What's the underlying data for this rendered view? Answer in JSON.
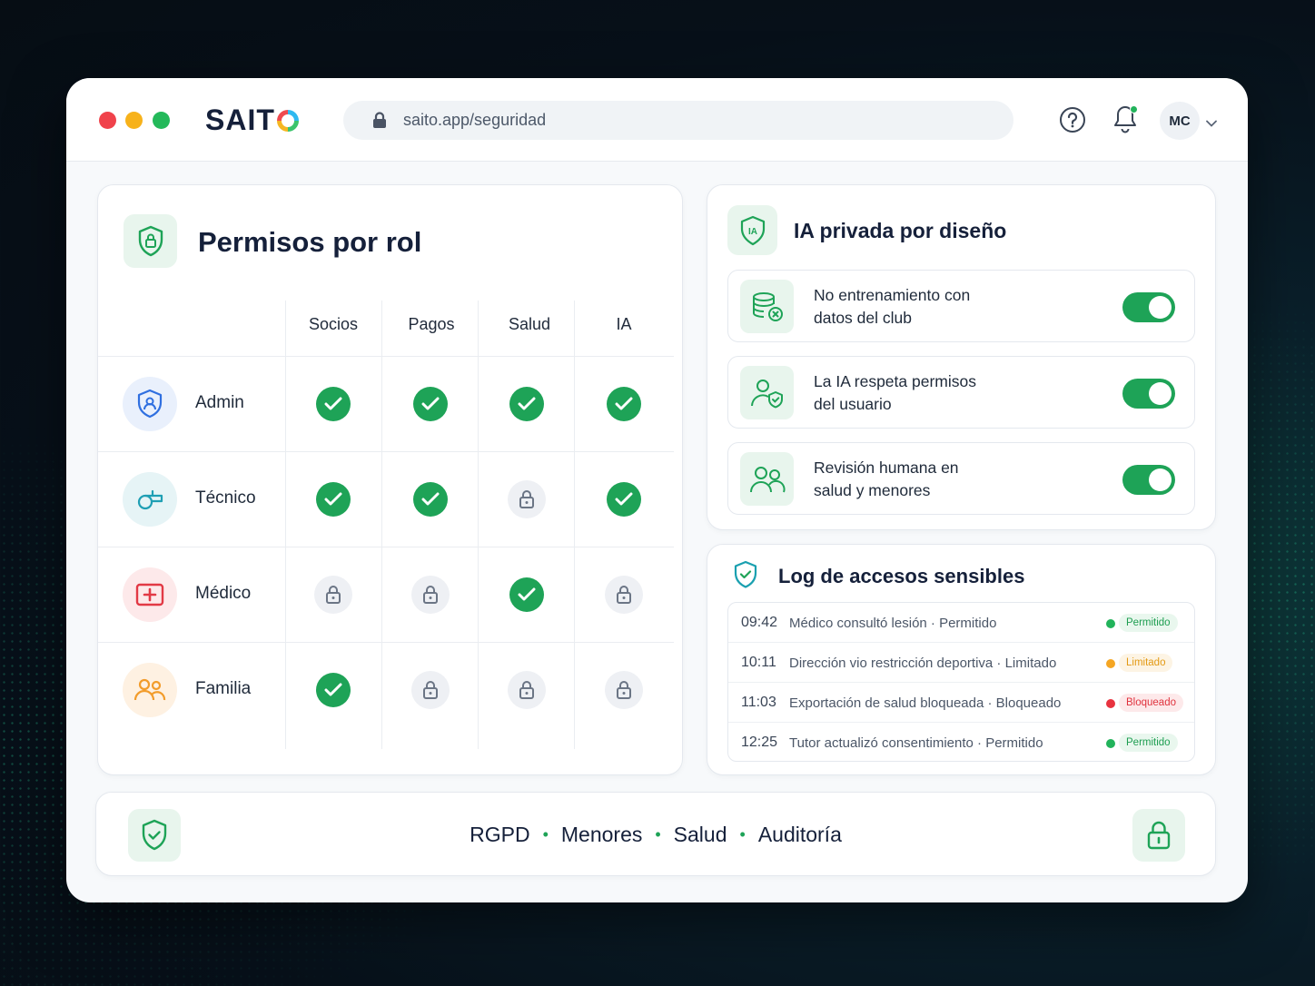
{
  "browser": {
    "logo": "SAIT",
    "url": "saito.app/seguridad",
    "avatar_initials": "MC"
  },
  "permissions": {
    "title": "Permisos por rol",
    "columns": [
      "Socios",
      "Pagos",
      "Salud",
      "IA"
    ],
    "roles": [
      {
        "label": "Admin",
        "access": [
          "allowed",
          "allowed",
          "allowed",
          "allowed"
        ]
      },
      {
        "label": "Técnico",
        "access": [
          "allowed",
          "allowed",
          "locked",
          "allowed"
        ]
      },
      {
        "label": "Médico",
        "access": [
          "locked",
          "locked",
          "allowed",
          "locked"
        ]
      },
      {
        "label": "Familia",
        "access": [
          "allowed",
          "locked",
          "locked",
          "locked"
        ]
      }
    ]
  },
  "private_ai": {
    "title": "IA privada por diseño",
    "items": [
      {
        "line1": "No entrenamiento con",
        "line2": "datos del club",
        "enabled": true
      },
      {
        "line1": "La IA respeta permisos",
        "line2": "del usuario",
        "enabled": true
      },
      {
        "line1": "Revisión humana en",
        "line2": "salud y menores",
        "enabled": true
      }
    ]
  },
  "access_log": {
    "title": "Log de accesos sensibles",
    "entries": [
      {
        "time": "09:42",
        "text": "Médico consultó lesión · Permitido",
        "status": "Permitido",
        "color": "#22b35b"
      },
      {
        "time": "10:11",
        "text": "Dirección vio restricción deportiva · Limitado",
        "status": "Limitado",
        "color": "#f5a623"
      },
      {
        "time": "11:03",
        "text": "Exportación de salud bloqueada · Bloqueado",
        "status": "Bloqueado",
        "color": "#e8333f"
      },
      {
        "time": "12:25",
        "text": "Tutor actualizó consentimiento · Permitido",
        "status": "Permitido",
        "color": "#22b35b"
      }
    ]
  },
  "footer": {
    "items": [
      "RGPD",
      "Menores",
      "Salud",
      "Auditoría"
    ]
  },
  "colors": {
    "accent": "#1ea357",
    "limited": "#f5a623",
    "blocked": "#e8333f"
  }
}
